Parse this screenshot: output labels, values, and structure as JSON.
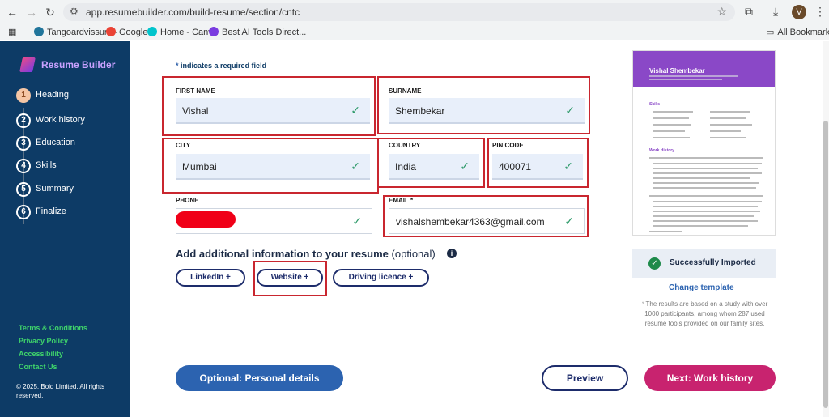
{
  "browser": {
    "url": "app.resumebuilder.com/build-resume/section/cntc",
    "profile_initial": "V",
    "bookmarks": [
      "Tangoardvissura -",
      "Google",
      "Home - Canva",
      "Best AI Tools Direct..."
    ],
    "all_bookmarks": "All Bookmarks"
  },
  "sidebar": {
    "brand": "Resume Builder",
    "steps": [
      {
        "num": "1",
        "label": "Heading"
      },
      {
        "num": "2",
        "label": "Work history"
      },
      {
        "num": "3",
        "label": "Education"
      },
      {
        "num": "4",
        "label": "Skills"
      },
      {
        "num": "5",
        "label": "Summary"
      },
      {
        "num": "6",
        "label": "Finalize"
      }
    ],
    "links": [
      "Terms & Conditions",
      "Privacy Policy",
      "Accessibility",
      "Contact Us"
    ],
    "copyright": "© 2025, Bold Limited. All rights reserved."
  },
  "form": {
    "required_note_star": "*",
    "required_note": "indicates a required field",
    "first_name_label": "FIRST NAME",
    "first_name_value": "Vishal",
    "surname_label": "SURNAME",
    "surname_value": "Shembekar",
    "city_label": "CITY",
    "city_value": "Mumbai",
    "country_label": "COUNTRY",
    "country_value": "India",
    "pin_label": "PIN CODE",
    "pin_value": "400071",
    "phone_label": "PHONE",
    "email_label": "EMAIL *",
    "email_value": "vishalshembekar4363@gmail.com"
  },
  "additional": {
    "title": "Add additional information to your resume",
    "optional": "(optional)",
    "chips": [
      "LinkedIn +",
      "Website +",
      "Driving licence +"
    ]
  },
  "buttons": {
    "personal": "Optional: Personal details",
    "preview": "Preview",
    "next": "Next: Work history"
  },
  "preview_card": {
    "name": "Vishal Shembekar",
    "skills": "Skills",
    "work": "Work History"
  },
  "status": {
    "success": "Successfully Imported",
    "change_template": "Change template",
    "note": "¹ The results are based on a study with over 1000 participants, among whom 287 used resume tools provided on our family sites."
  },
  "colors": {
    "sidebar": "#0d3b66",
    "accent_blue": "#2c63b0",
    "next_button": "#c8236f",
    "highlight_border": "#c9262f"
  }
}
